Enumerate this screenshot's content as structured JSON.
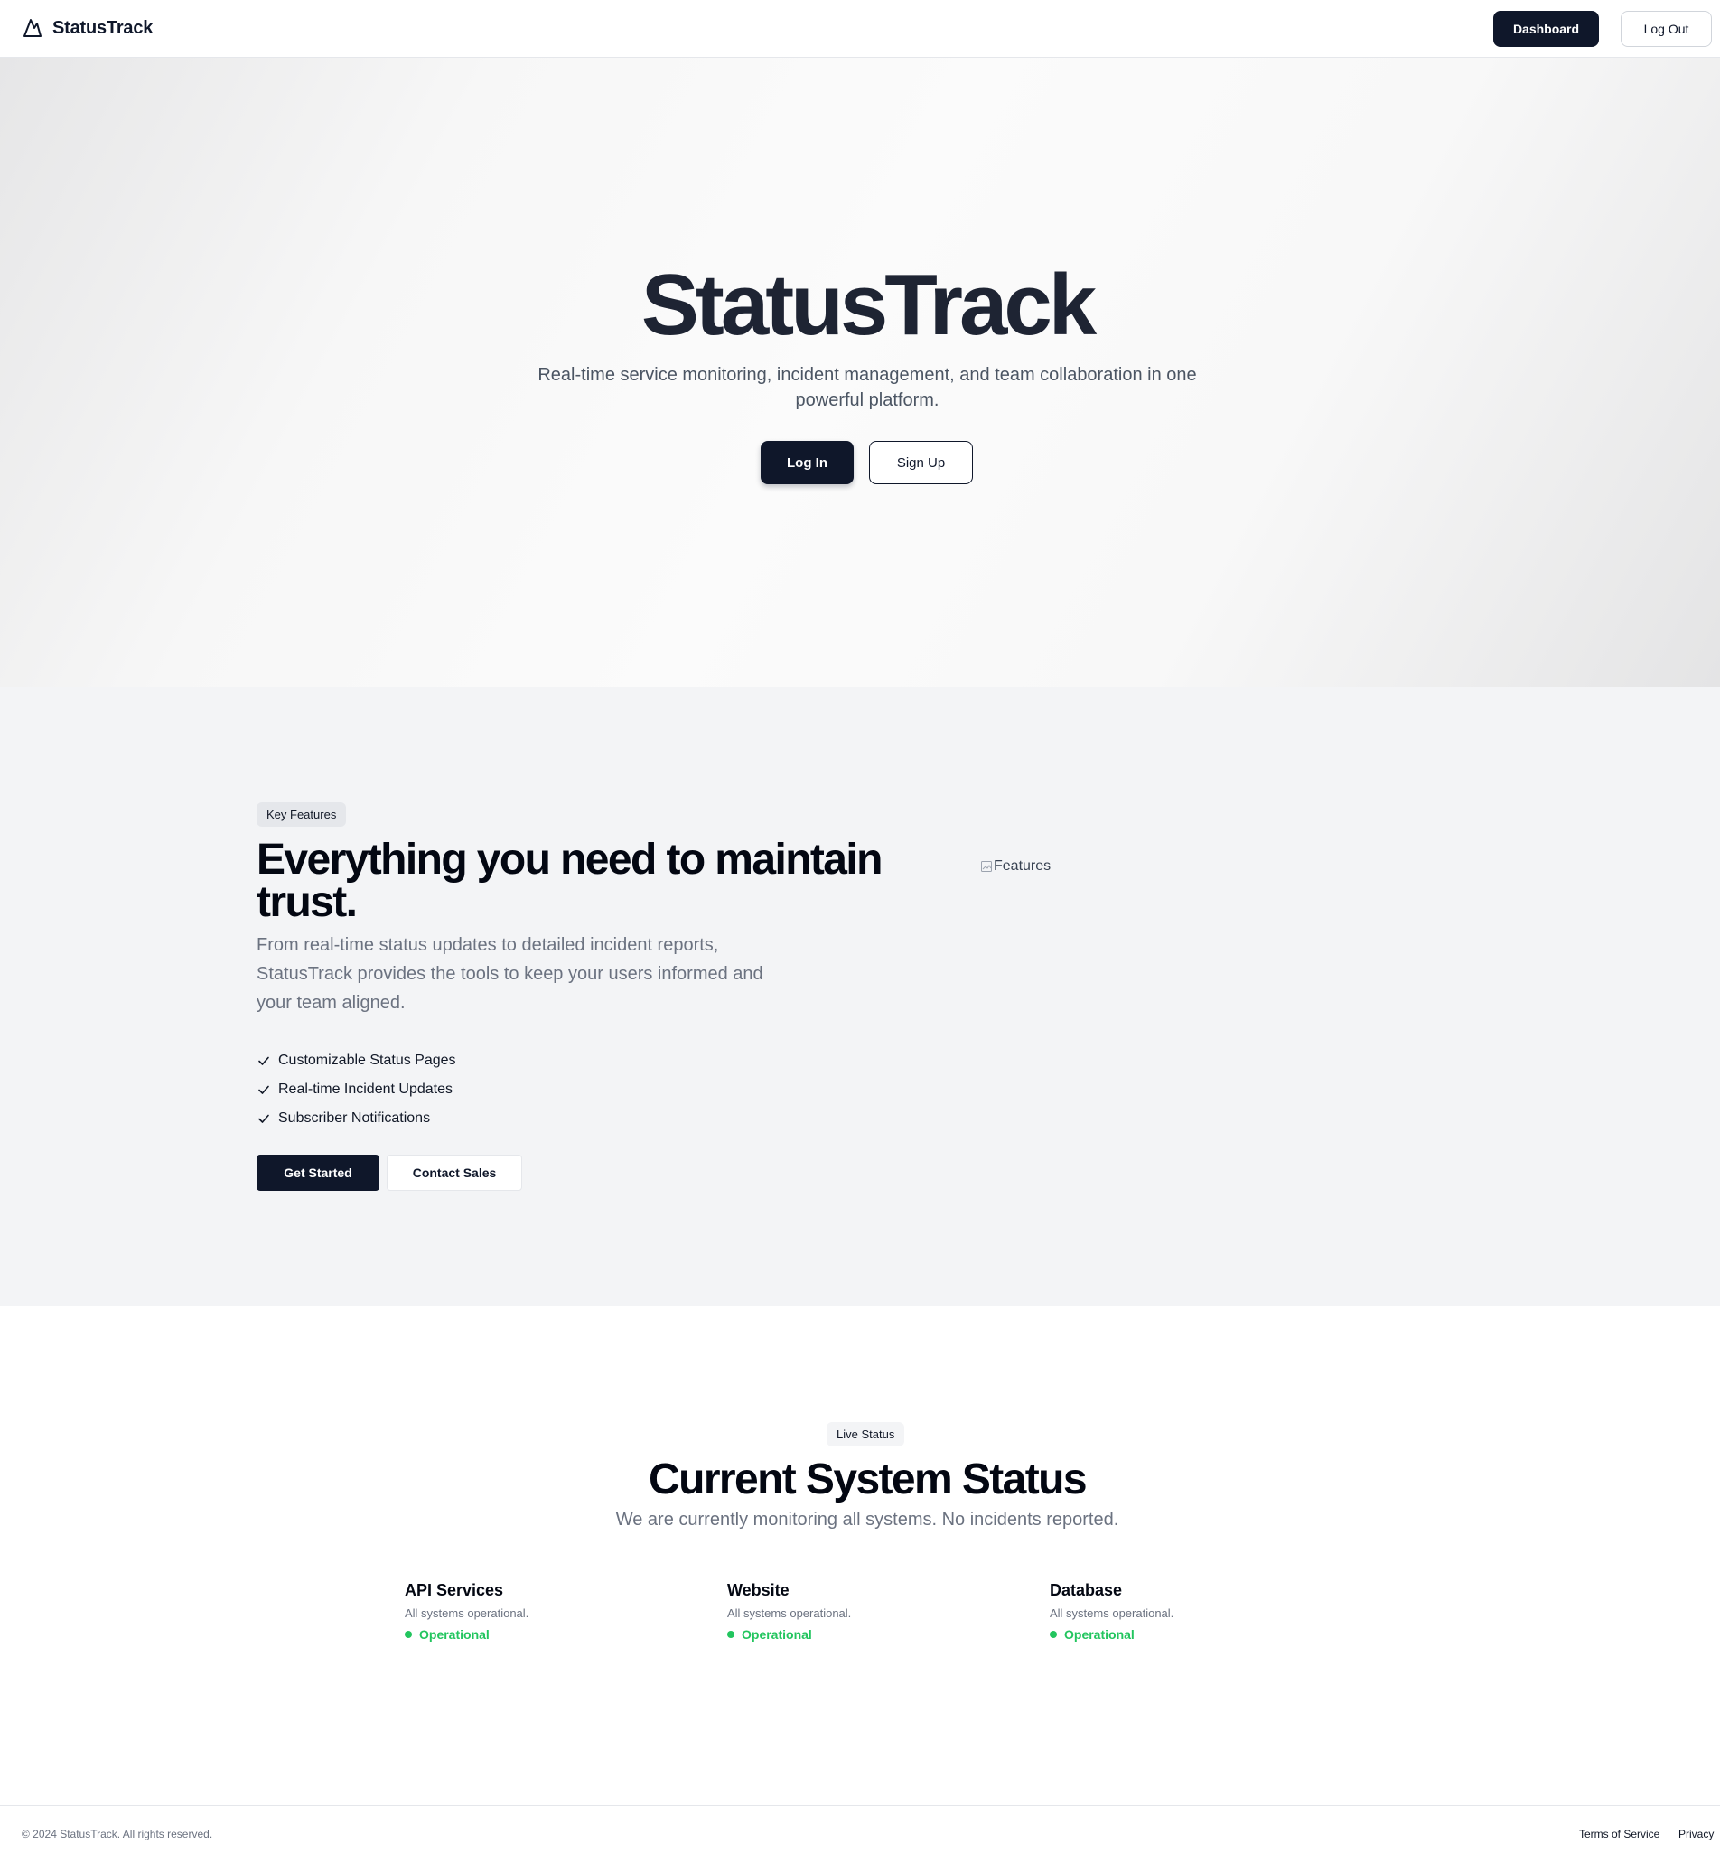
{
  "header": {
    "brand": "StatusTrack",
    "logo_icon": "mountain-icon",
    "dashboard_label": "Dashboard",
    "logout_label": "Log Out"
  },
  "hero": {
    "title": "StatusTrack",
    "subtitle": "Real-time service monitoring, incident management, and team collaboration in one powerful platform.",
    "login_label": "Log In",
    "signup_label": "Sign Up"
  },
  "features": {
    "badge": "Key Features",
    "heading": "Everything you need to maintain trust.",
    "description": "From real-time status updates to detailed incident reports, StatusTrack provides the tools to keep your users informed and your team aligned.",
    "items": [
      "Customizable Status Pages",
      "Real-time Incident Updates",
      "Subscriber Notifications"
    ],
    "check_icon": "check-icon",
    "get_started_label": "Get Started",
    "contact_sales_label": "Contact Sales",
    "image_alt": "Features"
  },
  "status": {
    "badge": "Live Status",
    "heading": "Current System Status",
    "subtitle": "We are currently monitoring all systems. No incidents reported.",
    "services": [
      {
        "name": "API Services",
        "description": "All systems operational.",
        "state": "Operational"
      },
      {
        "name": "Website",
        "description": "All systems operational.",
        "state": "Operational"
      },
      {
        "name": "Database",
        "description": "All systems operational.",
        "state": "Operational"
      }
    ],
    "operational_color": "#22c55e"
  },
  "footer": {
    "copyright": "© 2024 StatusTrack. All rights reserved.",
    "terms_label": "Terms of Service",
    "privacy_label": "Privacy"
  },
  "colors": {
    "primary_dark": "#0f172a",
    "muted_text": "#6b7280",
    "section_gray": "#f3f4f6"
  }
}
